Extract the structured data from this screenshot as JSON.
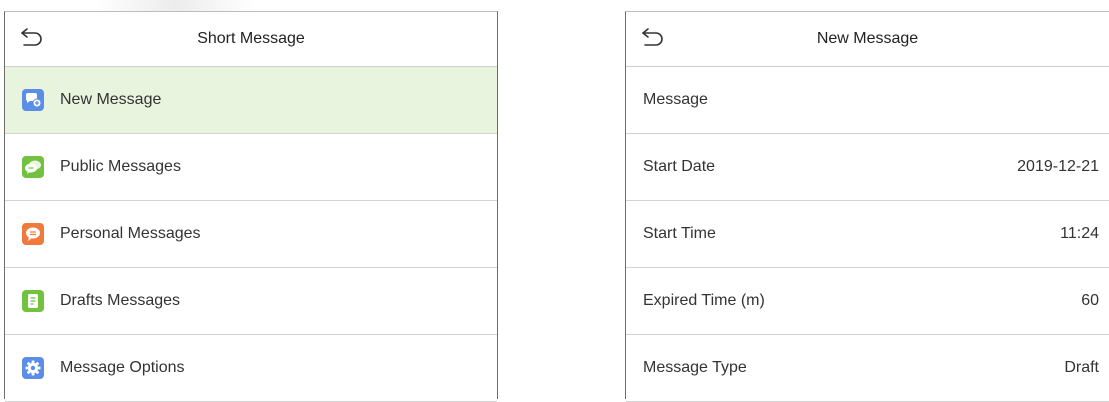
{
  "left_screen": {
    "title": "Short Message",
    "items": [
      {
        "label": "New Message",
        "icon": "new-message-icon",
        "color": "#5b8ee6"
      },
      {
        "label": "Public Messages",
        "icon": "public-messages-icon",
        "color": "#72c23f"
      },
      {
        "label": "Personal Messages",
        "icon": "personal-messages-icon",
        "color": "#f07a3c"
      },
      {
        "label": "Drafts Messages",
        "icon": "drafts-messages-icon",
        "color": "#72c23f"
      },
      {
        "label": "Message Options",
        "icon": "gear-icon",
        "color": "#5b8ee6"
      }
    ],
    "selected_color": "#e9f4df"
  },
  "right_screen": {
    "title": "New Message",
    "fields": [
      {
        "label": "Message",
        "value": ""
      },
      {
        "label": "Start Date",
        "value": "2019-12-21"
      },
      {
        "label": "Start Time",
        "value": "11:24"
      },
      {
        "label": "Expired Time (m)",
        "value": "60"
      },
      {
        "label": "Message Type",
        "value": "Draft"
      }
    ]
  }
}
